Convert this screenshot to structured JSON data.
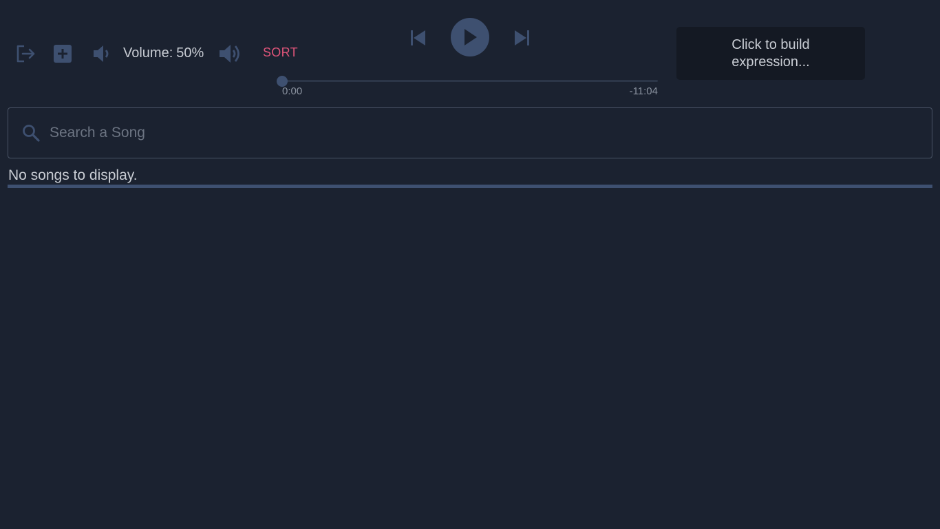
{
  "toolbar": {
    "logout_icon": "logout-icon",
    "add_icon": "add-box-icon",
    "volume_down_icon": "volume-down-icon",
    "volume_up_icon": "volume-up-icon",
    "volume_label": "Volume:",
    "volume_value": "50%",
    "sort_label": "SORT"
  },
  "player": {
    "prev_icon": "skip-previous-icon",
    "play_icon": "play-icon",
    "next_icon": "skip-next-icon",
    "time_elapsed": "0:00",
    "time_remaining": "-11:04",
    "progress_fraction": 0
  },
  "expression": {
    "text": "Click to build expression..."
  },
  "search": {
    "placeholder": "Search a Song",
    "value": ""
  },
  "songs": {
    "empty_message": "No songs to display."
  },
  "colors": {
    "background": "#1b2230",
    "accent": "#3e5070",
    "sort": "#e0557a",
    "expression_bg": "#141923"
  }
}
